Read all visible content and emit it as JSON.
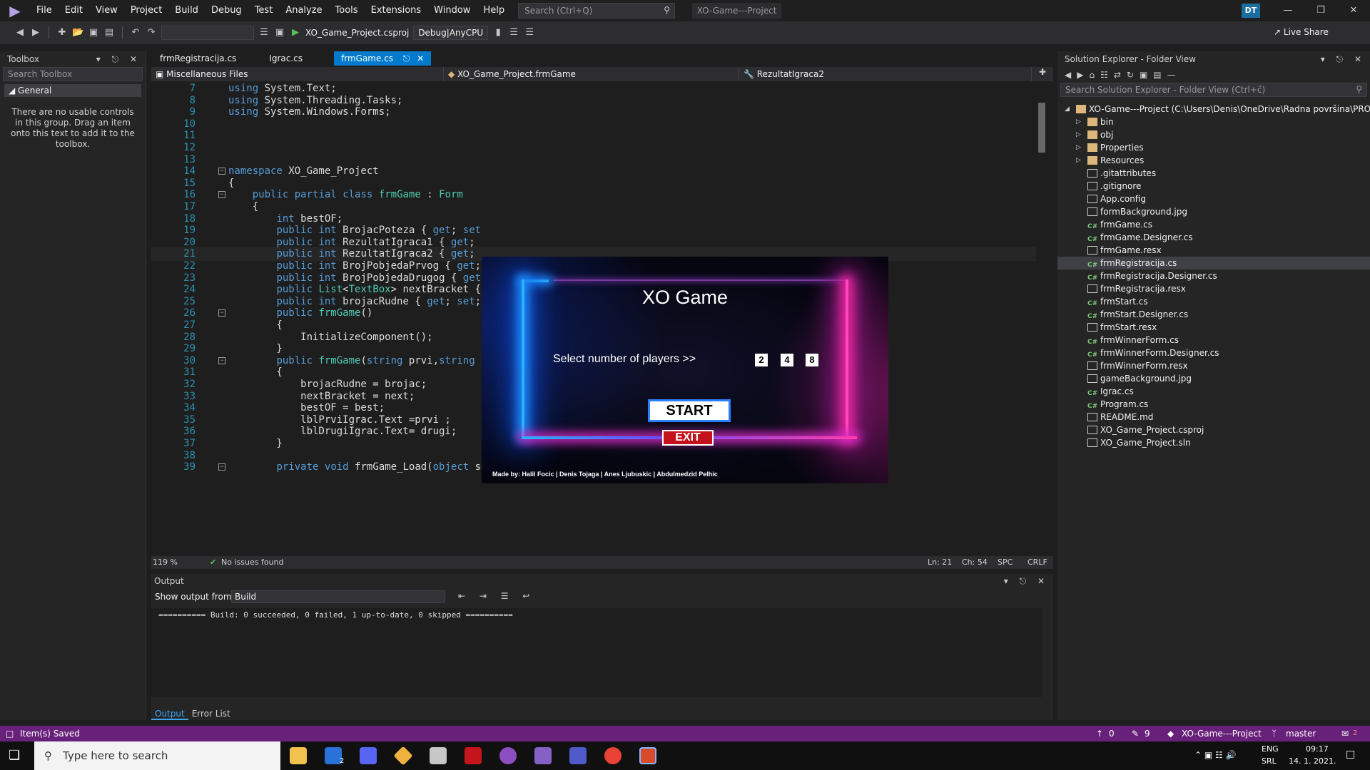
{
  "menu": {
    "items": [
      "File",
      "Edit",
      "View",
      "Project",
      "Build",
      "Debug",
      "Test",
      "Analyze",
      "Tools",
      "Extensions",
      "Window",
      "Help"
    ],
    "search_placeholder": "Search (Ctrl+Q)",
    "solution_title": "XO-Game---Project",
    "user_initials": "DT",
    "live_share": "Live Share"
  },
  "toolbar": {
    "start_project": "XO_Game_Project.csproj",
    "config": "Debug|AnyCPU"
  },
  "toolbox": {
    "title": "Toolbox",
    "search_placeholder": "Search Toolbox",
    "group": "General",
    "message": "There are no usable controls in this group. Drag an item onto this text to add it to the toolbox."
  },
  "editor": {
    "tabs": [
      "frmRegistracija.cs",
      "Igrac.cs",
      "frmGame.cs"
    ],
    "active_tab": "frmGame.cs",
    "nav": [
      "Miscellaneous Files",
      "XO_Game_Project.frmGame",
      "RezultatIgraca2"
    ],
    "zoom": "119 %",
    "issues": "No issues found",
    "ln": "Ln: 21",
    "ch": "Ch: 54",
    "spc": "SPC",
    "crlf": "CRLF",
    "lines": [
      {
        "n": "7",
        "t": "using System.Text;"
      },
      {
        "n": "8",
        "t": "using System.Threading.Tasks;"
      },
      {
        "n": "9",
        "t": "using System.Windows.Forms;"
      },
      {
        "n": "10",
        "t": ""
      },
      {
        "n": "11",
        "t": ""
      },
      {
        "n": "12",
        "t": ""
      },
      {
        "n": "13",
        "t": ""
      },
      {
        "n": "14",
        "t": "namespace XO_Game_Project"
      },
      {
        "n": "15",
        "t": "{"
      },
      {
        "n": "16",
        "t": "    public partial class frmGame : Form"
      },
      {
        "n": "17",
        "t": "    {"
      },
      {
        "n": "18",
        "t": "        int bestOF;"
      },
      {
        "n": "19",
        "t": "        public int BrojacPoteza { get; set"
      },
      {
        "n": "20",
        "t": "        public int RezultatIgraca1 { get;"
      },
      {
        "n": "21",
        "t": "        public int RezultatIgraca2 { get;"
      },
      {
        "n": "22",
        "t": "        public int BrojPobjedaPrvog { get;"
      },
      {
        "n": "23",
        "t": "        public int BrojPobjedaDrugog { get"
      },
      {
        "n": "24",
        "t": "        public List<TextBox> nextBracket {"
      },
      {
        "n": "25",
        "t": "        public int brojacRudne { get; set;"
      },
      {
        "n": "26",
        "t": "        public frmGame()"
      },
      {
        "n": "27",
        "t": "        {"
      },
      {
        "n": "28",
        "t": "            InitializeComponent();"
      },
      {
        "n": "29",
        "t": "        }"
      },
      {
        "n": "30",
        "t": "        public frmGame(string prvi,string"
      },
      {
        "n": "31",
        "t": "        {"
      },
      {
        "n": "32",
        "t": "            brojacRudne = brojac;"
      },
      {
        "n": "33",
        "t": "            nextBracket = next;"
      },
      {
        "n": "34",
        "t": "            bestOF = best;"
      },
      {
        "n": "35",
        "t": "            lblPrviIgrac.Text =prvi ;"
      },
      {
        "n": "36",
        "t": "            lblDrugiIgrac.Text= drugi;"
      },
      {
        "n": "37",
        "t": "        }"
      },
      {
        "n": "38",
        "t": ""
      },
      {
        "n": "39",
        "t": "        private void frmGame_Load(object sender, EventArgs e)"
      }
    ]
  },
  "game": {
    "title": "XO Game",
    "prompt": "Select number of players >>",
    "player_options": [
      "2",
      "4",
      "8"
    ],
    "start": "START",
    "exit": "EXIT",
    "credits": "Made by: Halil Focic | Denis Tojaga | Anes Ljubuskic | Abdulmedzid Pelhic"
  },
  "output": {
    "title": "Output",
    "show_from_label": "Show output from:",
    "source": "Build",
    "text": "========== Build: 0 succeeded, 0 failed, 1 up-to-date, 0 skipped ==========",
    "tabs": [
      "Output",
      "Error List"
    ]
  },
  "solution": {
    "title": "Solution Explorer - Folder View",
    "search_placeholder": "Search Solution Explorer - Folder View (Ctrl+č)",
    "root": "XO-Game---Project (C:\\Users\\Denis\\OneDrive\\Radna površina\\PROJECTS",
    "items": [
      {
        "name": "bin",
        "kind": "folder"
      },
      {
        "name": "obj",
        "kind": "folder"
      },
      {
        "name": "Properties",
        "kind": "folder"
      },
      {
        "name": "Resources",
        "kind": "folder"
      },
      {
        "name": ".gitattributes",
        "kind": "file"
      },
      {
        "name": ".gitignore",
        "kind": "file"
      },
      {
        "name": "App.config",
        "kind": "file"
      },
      {
        "name": "formBackground.jpg",
        "kind": "file"
      },
      {
        "name": "frmGame.cs",
        "kind": "cs"
      },
      {
        "name": "frmGame.Designer.cs",
        "kind": "cs"
      },
      {
        "name": "frmGame.resx",
        "kind": "file"
      },
      {
        "name": "frmRegistracija.cs",
        "kind": "cs"
      },
      {
        "name": "frmRegistracija.Designer.cs",
        "kind": "cs"
      },
      {
        "name": "frmRegistracija.resx",
        "kind": "file"
      },
      {
        "name": "frmStart.cs",
        "kind": "cs"
      },
      {
        "name": "frmStart.Designer.cs",
        "kind": "cs"
      },
      {
        "name": "frmStart.resx",
        "kind": "file"
      },
      {
        "name": "frmWinnerForm.cs",
        "kind": "cs"
      },
      {
        "name": "frmWinnerForm.Designer.cs",
        "kind": "cs"
      },
      {
        "name": "frmWinnerForm.resx",
        "kind": "file"
      },
      {
        "name": "gameBackground.jpg",
        "kind": "file"
      },
      {
        "name": "Igrac.cs",
        "kind": "cs"
      },
      {
        "name": "Program.cs",
        "kind": "cs"
      },
      {
        "name": "README.md",
        "kind": "file"
      },
      {
        "name": "XO_Game_Project.csproj",
        "kind": "file"
      },
      {
        "name": "XO_Game_Project.sln",
        "kind": "file"
      }
    ],
    "selected": "frmRegistracija.cs"
  },
  "statusbar": {
    "message": "Item(s) Saved",
    "up": "0",
    "edits": "9",
    "repo": "XO-Game---Project",
    "branch": "master",
    "notifications": "2"
  },
  "taskbar": {
    "search_placeholder": "Type here to search",
    "lang": "ENG",
    "layout": "SRL",
    "time": "09:17",
    "date": "14. 1. 2021.",
    "mail_badge": "2"
  },
  "colors": {
    "accent": "#007acc",
    "statusbar": "#68217a"
  }
}
